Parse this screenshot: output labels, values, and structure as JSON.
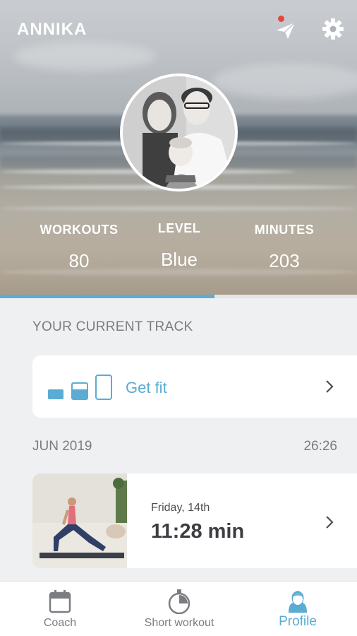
{
  "header": {
    "user_name": "ANNIKA",
    "icons": [
      "paper-plane-icon",
      "gear-icon"
    ],
    "notification_color": "#e5463f"
  },
  "stats": {
    "workouts": {
      "label": "WORKOUTS",
      "value": "80"
    },
    "level": {
      "label": "LEVEL",
      "value": "Blue"
    },
    "minutes": {
      "label": "MINUTES",
      "value": "203"
    }
  },
  "progress": {
    "fraction": 0.6,
    "color": "#5aacd3"
  },
  "current_track": {
    "section_title": "YOUR CURRENT TRACK",
    "name": "Get fit",
    "icon": "device-stages-icon"
  },
  "history": {
    "month": "JUN 2019",
    "total": "26:26",
    "workouts": [
      {
        "date": "Friday, 14th",
        "duration": "11:28 min"
      }
    ]
  },
  "bottom_nav": {
    "items": [
      {
        "label": "Coach",
        "icon": "calendar-icon"
      },
      {
        "label": "Short workout",
        "icon": "stopwatch-icon"
      },
      {
        "label": "Profile",
        "icon": "profile-icon",
        "active": true
      }
    ]
  },
  "colors": {
    "accent": "#5aacd3",
    "text_muted": "#7a7c80",
    "background": "#eff0f2"
  }
}
